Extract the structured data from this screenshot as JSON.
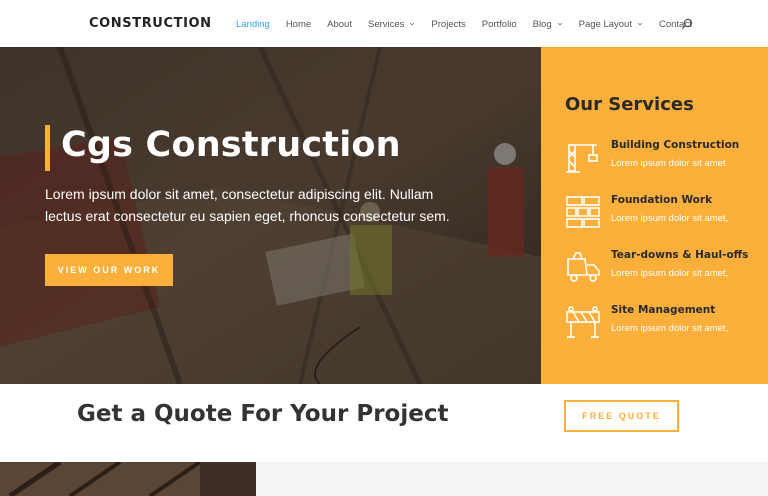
{
  "header": {
    "logo": "CONSTRUCTION",
    "nav": [
      {
        "label": "Landing",
        "active": true,
        "dropdown": false
      },
      {
        "label": "Home",
        "active": false,
        "dropdown": false
      },
      {
        "label": "About",
        "active": false,
        "dropdown": false
      },
      {
        "label": "Services",
        "active": false,
        "dropdown": true
      },
      {
        "label": "Projects",
        "active": false,
        "dropdown": false
      },
      {
        "label": "Portfolio",
        "active": false,
        "dropdown": false
      },
      {
        "label": "Blog",
        "active": false,
        "dropdown": true
      },
      {
        "label": "Page Layout",
        "active": false,
        "dropdown": true
      },
      {
        "label": "Contact",
        "active": false,
        "dropdown": false
      }
    ],
    "search_icon": "search-icon"
  },
  "hero": {
    "title": "Cgs Construction",
    "text": "Lorem ipsum dolor sit amet, consectetur adipiscing elit. Nullam lectus erat consectetur eu sapien eget, rhoncus consectetur sem.",
    "button": "VIEW OUR WORK"
  },
  "services": {
    "title": "Our Services",
    "items": [
      {
        "title": "Building Construction",
        "text": "Lorem ipsum dolor sit amet",
        "icon": "crane-icon"
      },
      {
        "title": "Foundation Work",
        "text": "Lorem ipsum dolor sit amet,",
        "icon": "bricks-icon"
      },
      {
        "title": "Tear-downs & Haul-offs",
        "text": "Lorem ipsum dolor sit amet,",
        "icon": "truck-icon"
      },
      {
        "title": "Site Management",
        "text": "Lorem ipsum dolor sit amet,",
        "icon": "barrier-icon"
      }
    ]
  },
  "quote": {
    "title": "Get a Quote For Your Project",
    "button": "FREE QUOTE"
  },
  "colors": {
    "accent": "#fcaf3b",
    "nav_active": "#2ea3f2",
    "heading": "#333333"
  }
}
